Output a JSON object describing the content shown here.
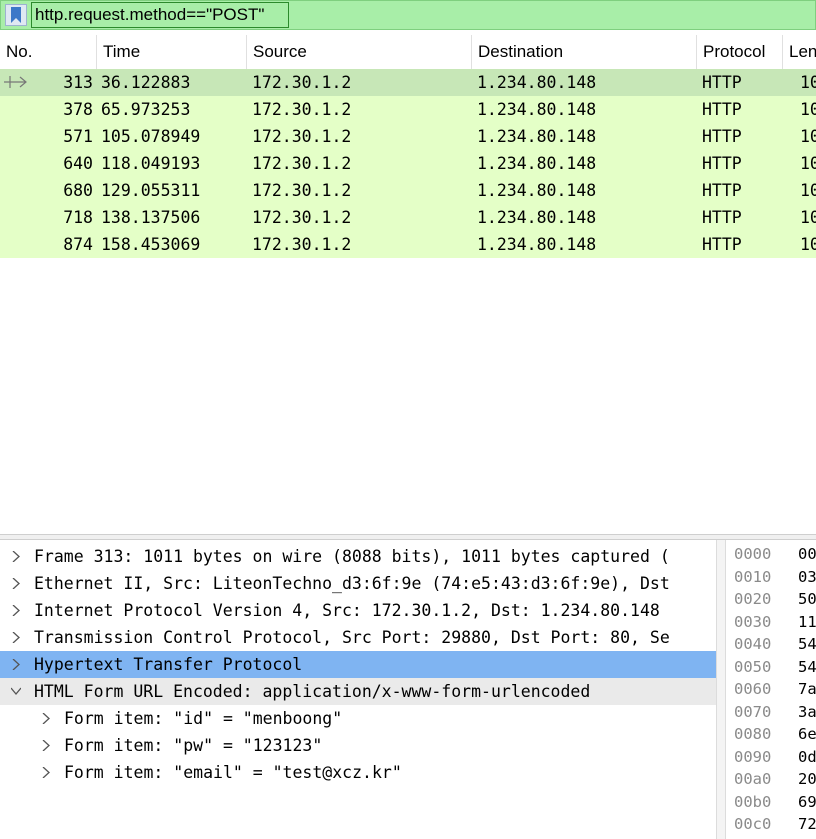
{
  "filter": {
    "value": "http.request.method==\"POST\"",
    "bookmark_icon": "bookmark-icon"
  },
  "columns": [
    "No.",
    "Time",
    "Source",
    "Destination",
    "Protocol",
    "Len"
  ],
  "packets": [
    {
      "no": "313",
      "time": "36.122883",
      "source": "172.30.1.2",
      "destination": "1.234.80.148",
      "protocol": "HTTP",
      "length": "10",
      "selected": true
    },
    {
      "no": "378",
      "time": "65.973253",
      "source": "172.30.1.2",
      "destination": "1.234.80.148",
      "protocol": "HTTP",
      "length": "10"
    },
    {
      "no": "571",
      "time": "105.078949",
      "source": "172.30.1.2",
      "destination": "1.234.80.148",
      "protocol": "HTTP",
      "length": "10"
    },
    {
      "no": "640",
      "time": "118.049193",
      "source": "172.30.1.2",
      "destination": "1.234.80.148",
      "protocol": "HTTP",
      "length": "10"
    },
    {
      "no": "680",
      "time": "129.055311",
      "source": "172.30.1.2",
      "destination": "1.234.80.148",
      "protocol": "HTTP",
      "length": "10"
    },
    {
      "no": "718",
      "time": "138.137506",
      "source": "172.30.1.2",
      "destination": "1.234.80.148",
      "protocol": "HTTP",
      "length": "10"
    },
    {
      "no": "874",
      "time": "158.453069",
      "source": "172.30.1.2",
      "destination": "1.234.80.148",
      "protocol": "HTTP",
      "length": "10"
    }
  ],
  "details": [
    {
      "label": "Frame 313: 1011 bytes on wire (8088 bits), 1011 bytes captured (",
      "expanded": false
    },
    {
      "label": "Ethernet II, Src: LiteonTechno_d3:6f:9e (74:e5:43:d3:6f:9e), Dst",
      "expanded": false
    },
    {
      "label": "Internet Protocol Version 4, Src: 172.30.1.2, Dst: 1.234.80.148",
      "expanded": false
    },
    {
      "label": "Transmission Control Protocol, Src Port: 29880, Dst Port: 80, Se",
      "expanded": false
    },
    {
      "label": "Hypertext Transfer Protocol",
      "expanded": false,
      "highlight": true
    },
    {
      "label": "HTML Form URL Encoded: application/x-www-form-urlencoded",
      "expanded": true
    },
    {
      "label": "Form item: \"id\" = \"menboong\"",
      "expanded": false,
      "child": true
    },
    {
      "label": "Form item: \"pw\" = \"123123\"",
      "expanded": false,
      "child": true
    },
    {
      "label": "Form item: \"email\" = \"test@xcz.kr\"",
      "expanded": false,
      "child": true
    }
  ],
  "hex": [
    {
      "offset": "0000",
      "bytes": "00"
    },
    {
      "offset": "0010",
      "bytes": "03"
    },
    {
      "offset": "0020",
      "bytes": "50"
    },
    {
      "offset": "0030",
      "bytes": "11"
    },
    {
      "offset": "0040",
      "bytes": "54"
    },
    {
      "offset": "0050",
      "bytes": "54"
    },
    {
      "offset": "0060",
      "bytes": "7a"
    },
    {
      "offset": "0070",
      "bytes": "3a"
    },
    {
      "offset": "0080",
      "bytes": "6e"
    },
    {
      "offset": "0090",
      "bytes": "0d"
    },
    {
      "offset": "00a0",
      "bytes": "20"
    },
    {
      "offset": "00b0",
      "bytes": "69"
    },
    {
      "offset": "00c0",
      "bytes": "72"
    }
  ],
  "colors": {
    "filter_ok": "#a8eea8",
    "row_bg": "#e4ffc7",
    "row_selected": "#c7e7b7",
    "detail_highlight": "#7fb4f2"
  }
}
